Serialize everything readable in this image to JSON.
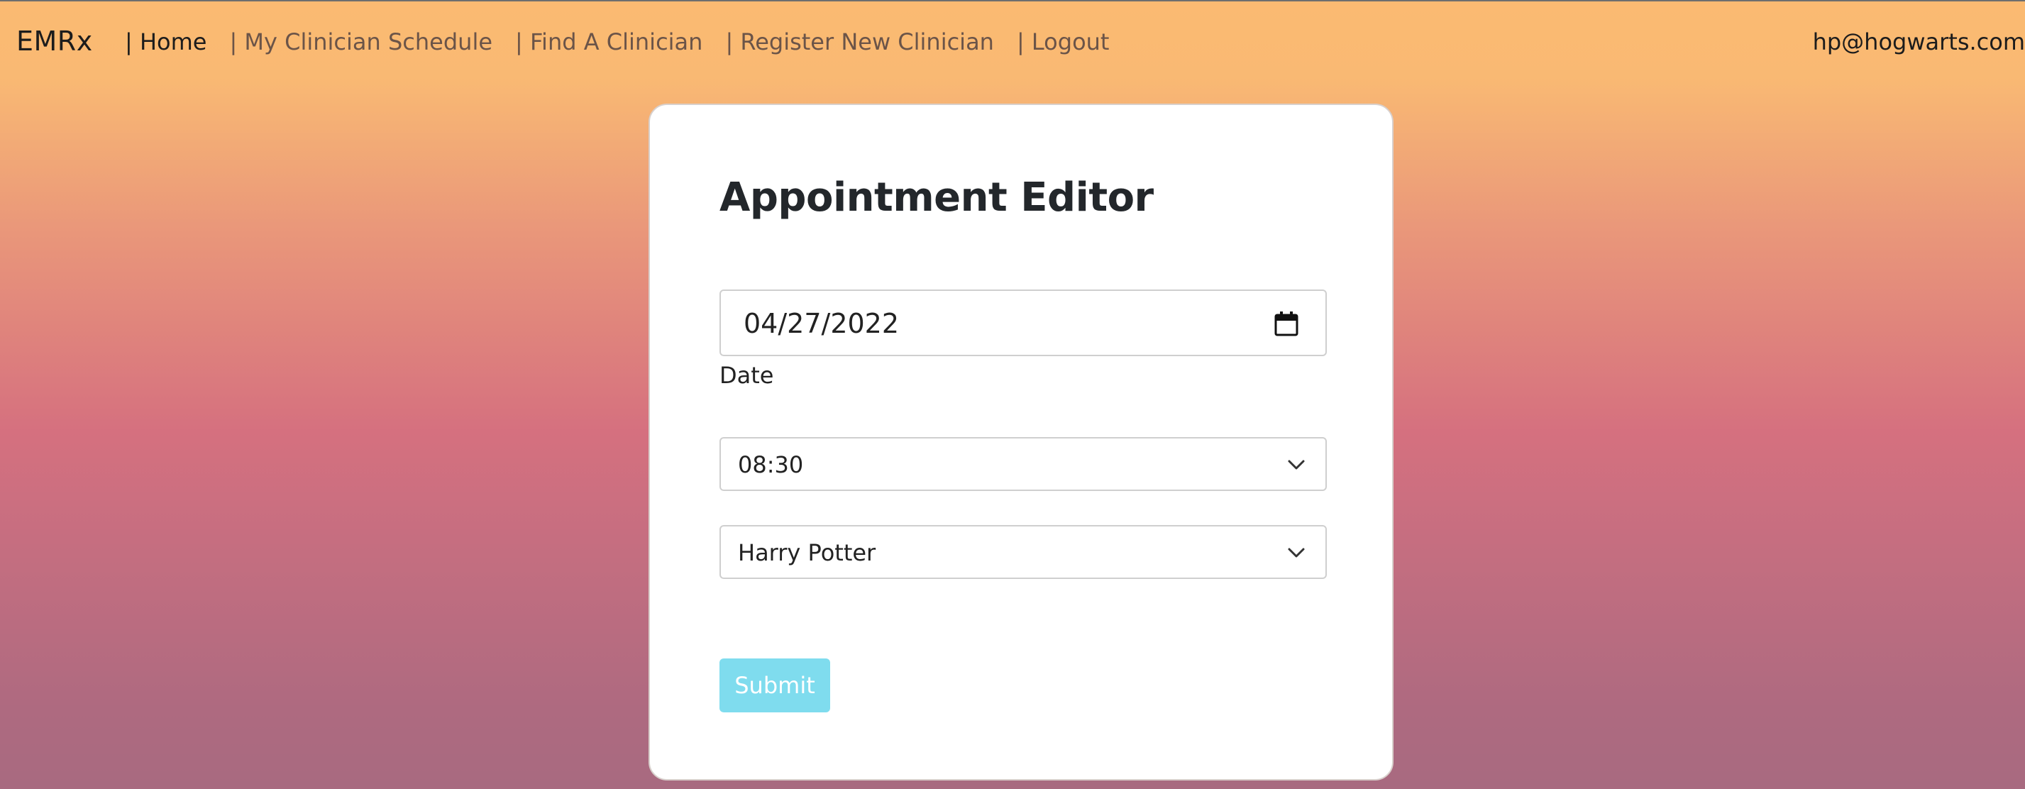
{
  "nav": {
    "brand": "EMRx",
    "links": [
      {
        "label": "| Home",
        "active": true
      },
      {
        "label": "| My Clinician Schedule",
        "active": false
      },
      {
        "label": "| Find A Clinician",
        "active": false
      },
      {
        "label": "| Register New Clinician",
        "active": false
      },
      {
        "label": "| Logout",
        "active": false
      }
    ],
    "user_email": "hp@hogwarts.com"
  },
  "form": {
    "title": "Appointment Editor",
    "date_value": "04/27/2022",
    "date_label": "Date",
    "time_value": "08:30",
    "clinician_value": "Harry Potter",
    "submit_label": "Submit"
  },
  "icons": {
    "calendar": "calendar-icon",
    "chevron": "chevron-down-icon"
  },
  "colors": {
    "submit_bg": "#7fdcee",
    "gradient_top": "#fbba72",
    "gradient_mid": "#d5707f",
    "gradient_bottom": "#a86a80"
  }
}
